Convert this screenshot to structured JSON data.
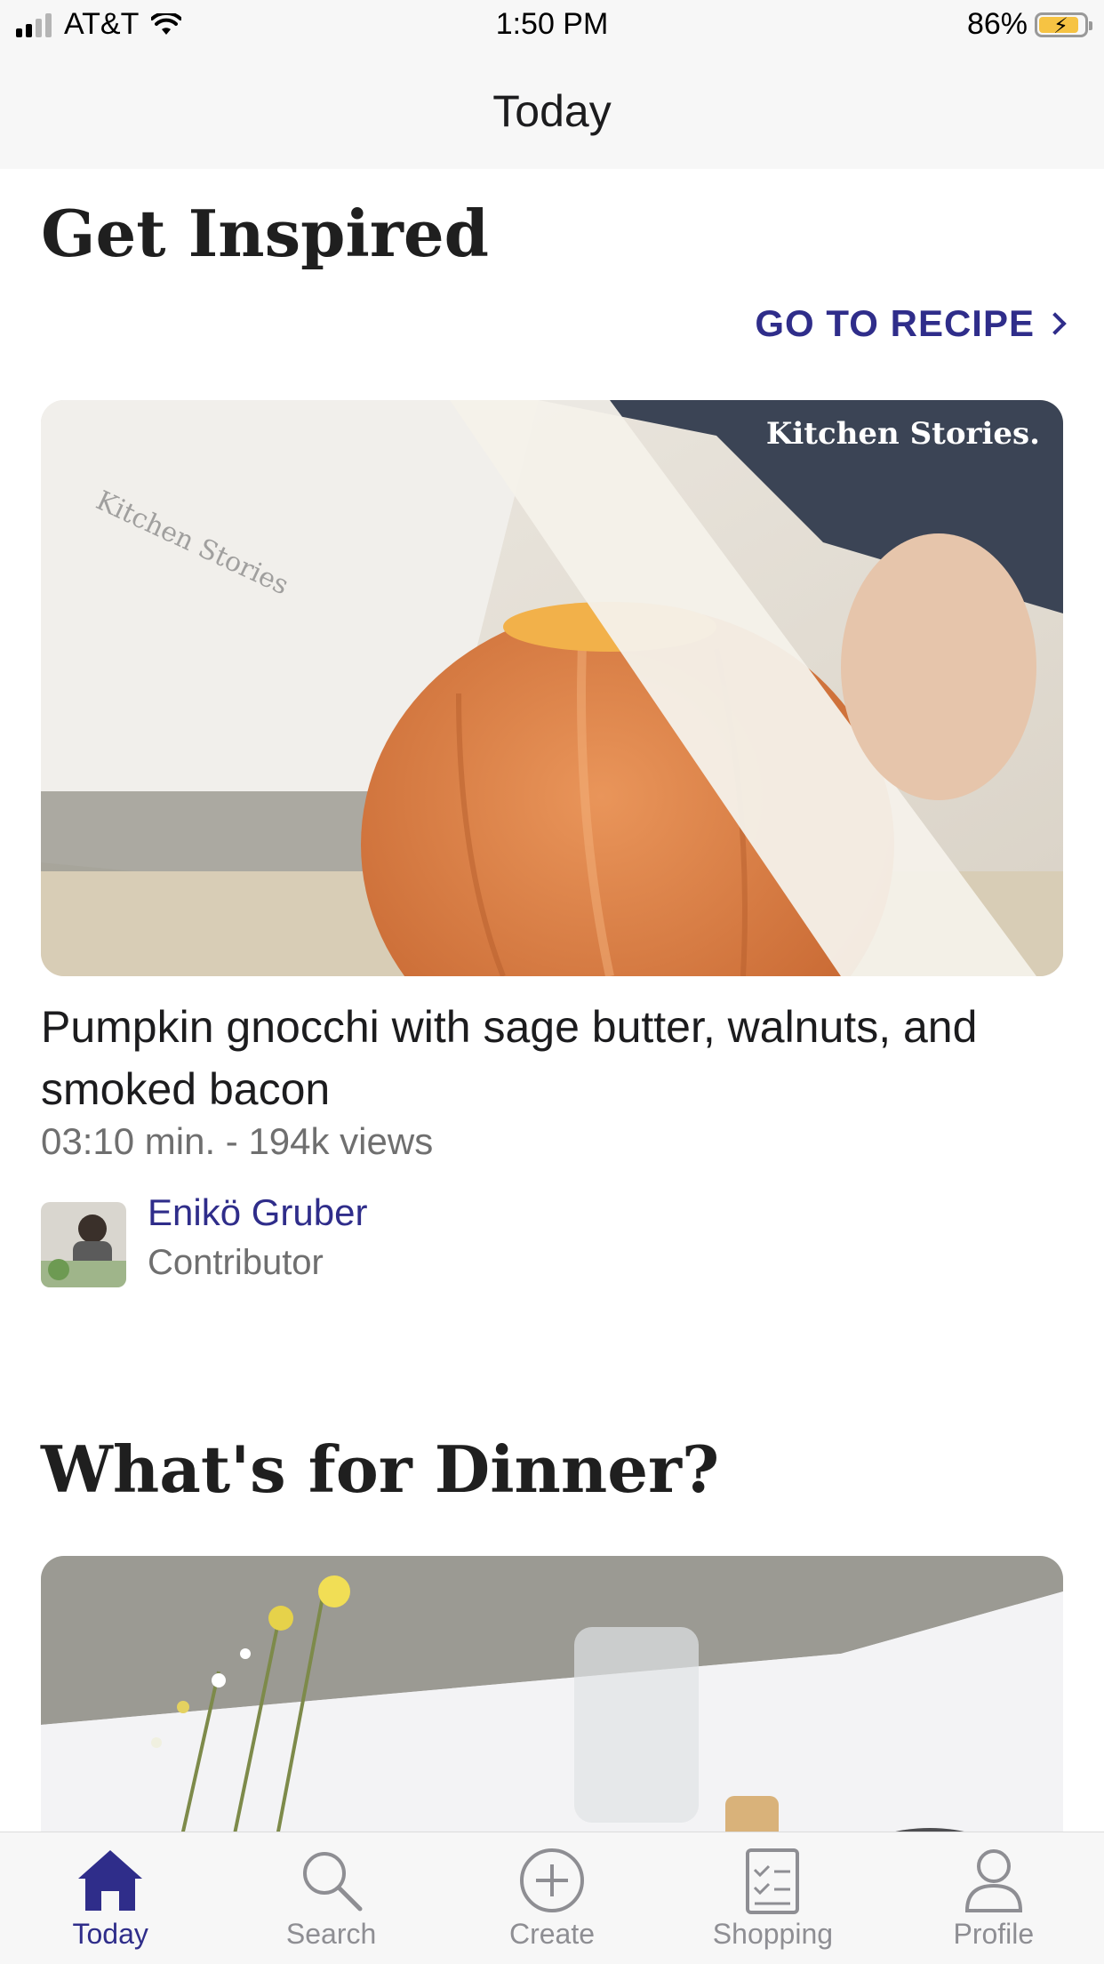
{
  "status_bar": {
    "carrier": "AT&T",
    "time": "1:50 PM",
    "battery": "86%"
  },
  "nav": {
    "title": "Today"
  },
  "inspired": {
    "title": "Get Inspired",
    "go_to_recipe": "GO TO RECIPE",
    "watermark": "Kitchen Stories.",
    "recipe_title": "Pumpkin gnocchi with sage butter, walnuts, and smoked bacon",
    "meta": "03:10 min. - 194k views",
    "author_name": "Enikö Gruber",
    "author_role": "Contributor"
  },
  "dinner": {
    "title": "What's for Dinner?"
  },
  "tabs": [
    {
      "label": "Today",
      "icon": "home-icon",
      "active": true
    },
    {
      "label": "Search",
      "icon": "search-icon",
      "active": false
    },
    {
      "label": "Create",
      "icon": "plus-circle-icon",
      "active": false
    },
    {
      "label": "Shopping",
      "icon": "checklist-icon",
      "active": false
    },
    {
      "label": "Profile",
      "icon": "person-icon",
      "active": false
    }
  ],
  "colors": {
    "accent": "#2f2d8a",
    "inactive": "#8e8e93",
    "bar_background": "#f7f7f7"
  }
}
